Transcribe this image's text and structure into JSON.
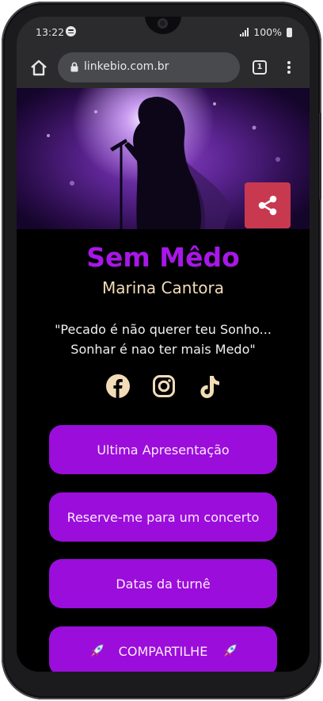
{
  "status_bar": {
    "time": "13:22",
    "battery": "100%"
  },
  "browser": {
    "url": "linkebio.com.br",
    "tab_count": "1"
  },
  "profile": {
    "title": "Sem Mêdo",
    "subtitle": "Marina Cantora",
    "quote_line1": "\"Pecado é não querer teu Sonho...",
    "quote_line2": "Sonhar é nao ter mais Medo\""
  },
  "social": [
    "facebook-icon",
    "instagram-icon",
    "tiktok-icon"
  ],
  "links": [
    "Ultima Apresentação",
    "Reserve-me para um concerto",
    "Datas da turnê",
    "COMPARTILHE"
  ],
  "colors": {
    "accent": "#9b0ddb",
    "title": "#a817e8",
    "subtitle": "#f2dcb8",
    "share": "#c8394f"
  }
}
